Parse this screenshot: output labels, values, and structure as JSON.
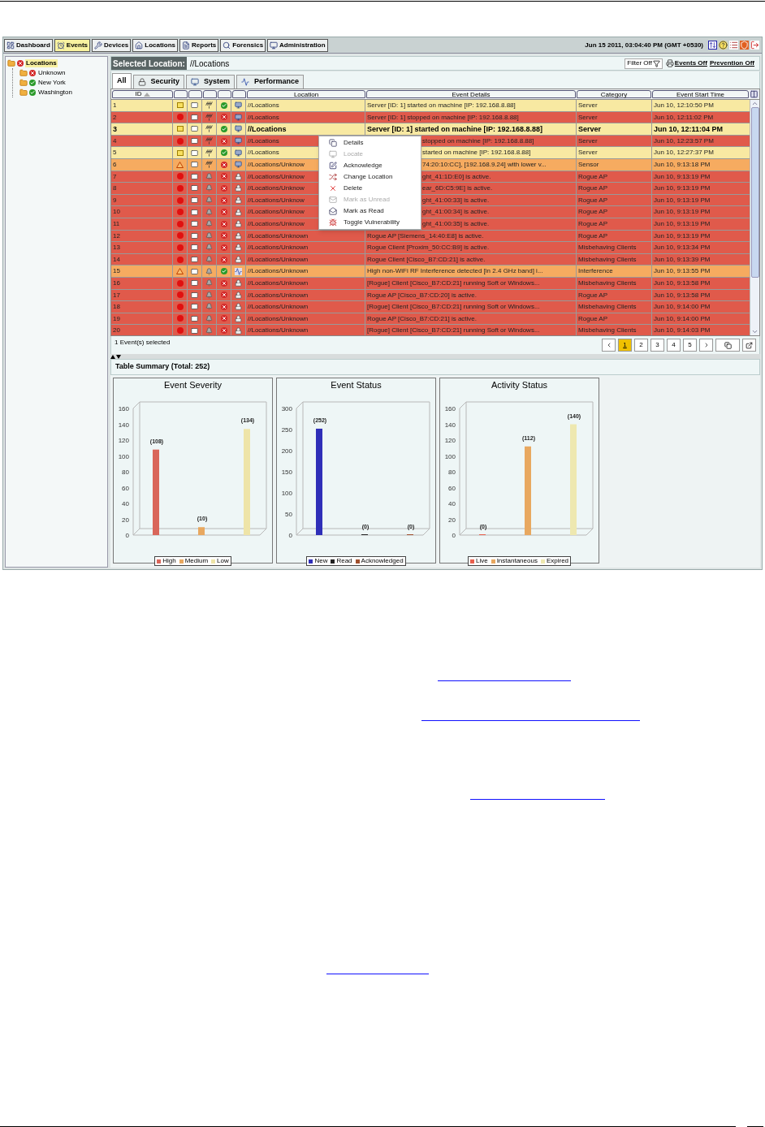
{
  "nav": {
    "tabs": [
      {
        "label": "Dashboard",
        "selected": false
      },
      {
        "label": "Events",
        "selected": true
      },
      {
        "label": "Devices",
        "selected": false
      },
      {
        "label": "Locations",
        "selected": false
      },
      {
        "label": "Reports",
        "selected": false
      },
      {
        "label": "Forensics",
        "selected": false
      },
      {
        "label": "Administration",
        "selected": false
      }
    ],
    "datetime": "Jun 15 2011, 03:04:40 PM (GMT +0530)"
  },
  "tree": {
    "label": "Locations",
    "ok": false,
    "selected": true,
    "children": [
      {
        "label": "Unknown",
        "ok": false,
        "selected": false
      },
      {
        "label": "New York",
        "ok": true,
        "selected": false
      },
      {
        "label": "Washington",
        "ok": true,
        "selected": false
      }
    ]
  },
  "location_bar": {
    "label": "Selected Location:",
    "value": "//Locations",
    "filter": "Filter Off",
    "events": "Events Off",
    "prevention": "Prevention Off"
  },
  "event_tabs": [
    {
      "label": "All",
      "kind": "all",
      "selected": true
    },
    {
      "label": "Security",
      "kind": "security",
      "selected": false
    },
    {
      "label": "System",
      "kind": "system",
      "selected": false
    },
    {
      "label": "Performance",
      "kind": "performance",
      "selected": false
    }
  ],
  "table": {
    "columns": {
      "id": "ID",
      "location": "Location",
      "details": "Event Details",
      "category": "Category",
      "time": "Event Start Time"
    },
    "sorted_ascending": true,
    "rows": [
      {
        "id": "1",
        "kind": "low",
        "alarm": false,
        "ok": true,
        "event_type": {
          "kind": "system"
        },
        "location": "//Locations",
        "details": "Server [ID: 1] started on machine [IP: 192.168.8.88]",
        "category": "Server",
        "time": "Jun 10, 12:10:50 PM",
        "selected": false
      },
      {
        "id": "2",
        "kind": "high",
        "alarm": false,
        "ok": false,
        "event_type": {
          "kind": "system"
        },
        "location": "//Locations",
        "details": "Server [ID: 1] stopped on machine [IP: 192.168.8.88]",
        "category": "Server",
        "time": "Jun 10, 12:11:02 PM",
        "selected": false
      },
      {
        "id": "3",
        "kind": "low",
        "alarm": false,
        "ok": true,
        "event_type": {
          "kind": "system"
        },
        "location": "//Locations",
        "details": "Server [ID: 1] started on machine [IP: 192.168.8.88]",
        "category": "Server",
        "time": "Jun 10, 12:11:04 PM",
        "selected": true
      },
      {
        "id": "4",
        "kind": "high",
        "alarm": false,
        "ok": false,
        "event_type": {
          "kind": "system"
        },
        "location": "//Locations",
        "details": "stopped on machine [IP: 192.168.8.88]",
        "category": "Server",
        "time": "Jun 10, 12:23:57 PM",
        "selected": false
      },
      {
        "id": "5",
        "kind": "low",
        "alarm": false,
        "ok": true,
        "event_type": {
          "kind": "system"
        },
        "location": "//Locations",
        "details": "started on machine [IP: 192.168.8.88]",
        "category": "Server",
        "time": "Jun 10, 12:27:37 PM",
        "selected": false
      },
      {
        "id": "6",
        "kind": "medium",
        "alarm": false,
        "ok": false,
        "event_type": {
          "kind": "system"
        },
        "location": "//Locations/Unknow",
        "details": "74:20:10:CC], [192.168.9.24] with lower v...",
        "category": "Sensor",
        "time": "Jun 10, 9:13:18 PM",
        "selected": false
      },
      {
        "id": "7",
        "kind": "high",
        "alarm": true,
        "ok": false,
        "event_type": {
          "kind": "security"
        },
        "location": "//Locations/Unknow",
        "details": "ght_41:1D:E0] is active.",
        "category": "Rogue AP",
        "time": "Jun 10, 9:13:19 PM",
        "selected": false
      },
      {
        "id": "8",
        "kind": "high",
        "alarm": true,
        "ok": false,
        "event_type": {
          "kind": "security"
        },
        "location": "//Locations/Unknow",
        "details": "ear_6D:C5:9E] is active.",
        "category": "Rogue AP",
        "time": "Jun 10, 9:13:19 PM",
        "selected": false
      },
      {
        "id": "9",
        "kind": "high",
        "alarm": true,
        "ok": false,
        "event_type": {
          "kind": "security"
        },
        "location": "//Locations/Unknow",
        "details": "ght_41:00:33] is active.",
        "category": "Rogue AP",
        "time": "Jun 10, 9:13:19 PM",
        "selected": false
      },
      {
        "id": "10",
        "kind": "high",
        "alarm": true,
        "ok": false,
        "event_type": {
          "kind": "security"
        },
        "location": "//Locations/Unknow",
        "details": "ght_41:00:34] is active.",
        "category": "Rogue AP",
        "time": "Jun 10, 9:13:19 PM",
        "selected": false
      },
      {
        "id": "11",
        "kind": "high",
        "alarm": true,
        "ok": false,
        "event_type": {
          "kind": "security"
        },
        "location": "//Locations/Unknow",
        "details": "ght_41:00:35] is active.",
        "category": "Rogue AP",
        "time": "Jun 10, 9:13:19 PM",
        "selected": false
      },
      {
        "id": "12",
        "kind": "high",
        "alarm": true,
        "ok": false,
        "event_type": {
          "kind": "security"
        },
        "location": "//Locations/Unknown",
        "details": "Rogue AP [Siemens_14:40:E8] is active.",
        "category": "Rogue AP",
        "time": "Jun 10, 9:13:19 PM",
        "selected": false
      },
      {
        "id": "13",
        "kind": "high",
        "alarm": true,
        "ok": false,
        "event_type": {
          "kind": "security"
        },
        "location": "//Locations/Unknown",
        "details": "Rogue Client [Proxim_50:CC:B9] is active.",
        "category": "Misbehaving Clients",
        "time": "Jun 10, 9:13:34 PM",
        "selected": false
      },
      {
        "id": "14",
        "kind": "high",
        "alarm": true,
        "ok": false,
        "event_type": {
          "kind": "security"
        },
        "location": "//Locations/Unknown",
        "details": "Rogue Client [Cisco_B7:CD:21] is active.",
        "category": "Misbehaving Clients",
        "time": "Jun 10, 9:13:39 PM",
        "selected": false
      },
      {
        "id": "15",
        "kind": "medium",
        "alarm": true,
        "ok": true,
        "event_type": {
          "kind": "performance"
        },
        "location": "//Locations/Unknown",
        "details": "High non-WiFi RF Interference detected [in 2.4 GHz band] i...",
        "category": "Interference",
        "time": "Jun 10, 9:13:55 PM",
        "selected": false
      },
      {
        "id": "16",
        "kind": "high",
        "alarm": true,
        "ok": false,
        "event_type": {
          "kind": "security"
        },
        "location": "//Locations/Unknown",
        "details": "[Rogue] Client [Cisco_B7:CD:21] running Soft or Windows...",
        "category": "Misbehaving Clients",
        "time": "Jun 10, 9:13:58 PM",
        "selected": false
      },
      {
        "id": "17",
        "kind": "high",
        "alarm": true,
        "ok": false,
        "event_type": {
          "kind": "security"
        },
        "location": "//Locations/Unknown",
        "details": "Rogue AP [Cisco_B7:CD:20] is active.",
        "category": "Rogue AP",
        "time": "Jun 10, 9:13:58 PM",
        "selected": false
      },
      {
        "id": "18",
        "kind": "high",
        "alarm": true,
        "ok": false,
        "event_type": {
          "kind": "security"
        },
        "location": "//Locations/Unknown",
        "details": "[Rogue] Client [Cisco_B7:CD:21] running Soft or Windows...",
        "category": "Misbehaving Clients",
        "time": "Jun 10, 9:14:00 PM",
        "selected": false
      },
      {
        "id": "19",
        "kind": "high",
        "alarm": true,
        "ok": false,
        "event_type": {
          "kind": "security"
        },
        "location": "//Locations/Unknown",
        "details": "Rogue AP [Cisco_B7:CD:21] is active.",
        "category": "Rogue AP",
        "time": "Jun 10, 9:14:00 PM",
        "selected": false
      },
      {
        "id": "20",
        "kind": "high",
        "alarm": true,
        "ok": false,
        "event_type": {
          "kind": "security"
        },
        "location": "//Locations/Unknown",
        "details": "[Rogue] Client [Cisco_B7:CD:21] running Soft or Windows...",
        "category": "Misbehaving Clients",
        "time": "Jun 10, 9:14:03 PM",
        "selected": false
      }
    ]
  },
  "context_menu": [
    {
      "label": "Details",
      "kind": "details",
      "disabled": false
    },
    {
      "label": "Locate",
      "kind": "locate",
      "disabled": true
    },
    {
      "label": "Acknowledge",
      "kind": "acknowledge",
      "disabled": false
    },
    {
      "label": "Change Location",
      "kind": "move",
      "disabled": false
    },
    {
      "label": "Delete",
      "kind": "delete",
      "disabled": false
    },
    {
      "label": "Mark as Unread",
      "kind": "unread",
      "disabled": true
    },
    {
      "label": "Mark as Read",
      "kind": "read",
      "disabled": false
    },
    {
      "label": "Toggle Vulnerability",
      "kind": "vulnerability",
      "disabled": false
    }
  ],
  "selection_status": "1 Event(s) selected",
  "pager": [
    {
      "label": "1",
      "selected": true
    },
    {
      "label": "2",
      "selected": false
    },
    {
      "label": "3",
      "selected": false
    },
    {
      "label": "4",
      "selected": false
    },
    {
      "label": "5",
      "selected": false
    }
  ],
  "summary": {
    "title": "Table Summary (Total: 252)",
    "charts": [
      {
        "legend": [
          {
            "label": "High",
            "color": "#d9665a"
          },
          {
            "label": "Medium",
            "color": "#e8a860"
          },
          {
            "label": "Low",
            "color": "#eee4a8"
          }
        ],
        "chart_data": {
          "type": "bar",
          "title": "Event Severity",
          "categories": [
            null,
            null,
            null
          ],
          "values": [
            108,
            10,
            134
          ],
          "ylim": [
            0,
            160
          ],
          "yticks": [
            0,
            20,
            40,
            60,
            80,
            100,
            120,
            140,
            160
          ],
          "value_labels": [
            "(108)",
            "(10)",
            "(134)"
          ]
        }
      },
      {
        "legend": [
          {
            "label": "New",
            "color": "#2f2fb8"
          },
          {
            "label": "Read",
            "color": "#222222"
          },
          {
            "label": "Acknowledged",
            "color": "#a0502e"
          }
        ],
        "chart_data": {
          "type": "bar",
          "title": "Event Status",
          "categories": [
            null,
            null,
            null
          ],
          "values": [
            252,
            0,
            0
          ],
          "ylim": [
            0,
            300
          ],
          "yticks": [
            0,
            50,
            100,
            150,
            200,
            250,
            300
          ],
          "value_labels": [
            "(252)",
            "(0)",
            "(0)"
          ]
        }
      },
      {
        "legend": [
          {
            "label": "Live",
            "color": "#e8604e"
          },
          {
            "label": "Instantaneous",
            "color": "#e8a860"
          },
          {
            "label": "Expired",
            "color": "#eee8b0"
          }
        ],
        "chart_data": {
          "type": "bar",
          "title": "Activity Status",
          "categories": [
            null,
            null,
            null
          ],
          "values": [
            0,
            112,
            140
          ],
          "ylim": [
            0,
            160
          ],
          "yticks": [
            0,
            20,
            40,
            60,
            80,
            100,
            120,
            140,
            160
          ],
          "value_labels": [
            "(0)",
            "(112)",
            "(140)"
          ]
        }
      }
    ]
  }
}
